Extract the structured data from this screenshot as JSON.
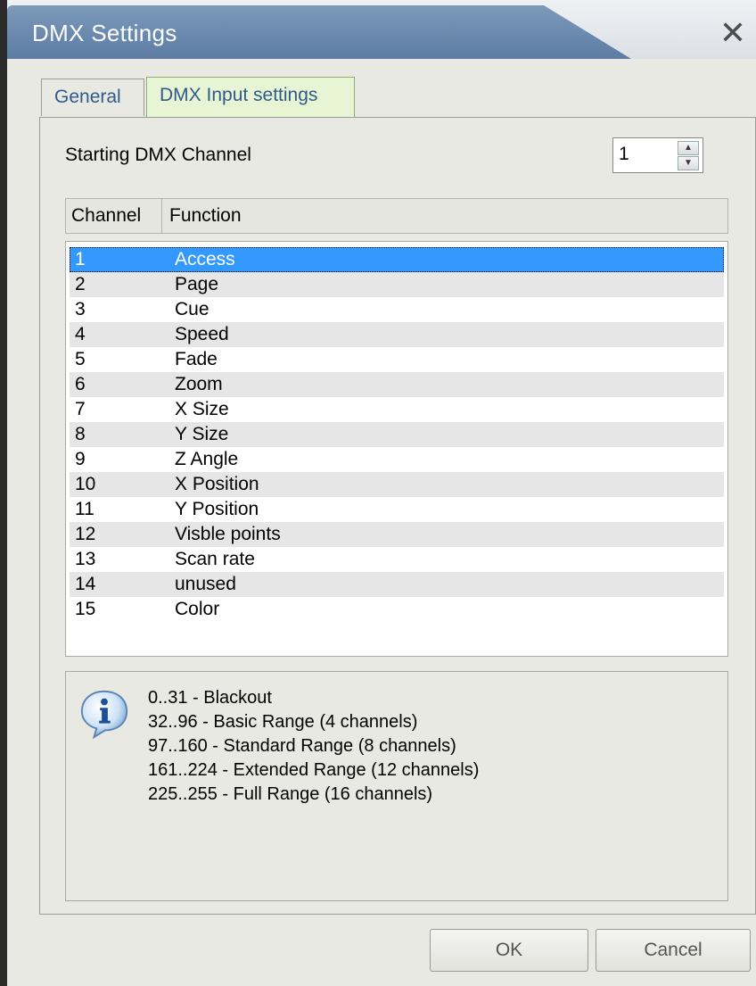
{
  "window": {
    "title": "DMX Settings",
    "close_glyph": "✕"
  },
  "tabs": [
    {
      "label": "General"
    },
    {
      "label": "DMX Input settings"
    }
  ],
  "start_channel": {
    "label": "Starting DMX Channel",
    "value": "1"
  },
  "table": {
    "columns": [
      "Channel",
      "Function"
    ],
    "rows": [
      {
        "channel": "1",
        "function": "Access"
      },
      {
        "channel": "2",
        "function": "Page"
      },
      {
        "channel": "3",
        "function": "Cue"
      },
      {
        "channel": "4",
        "function": "Speed"
      },
      {
        "channel": "5",
        "function": "Fade"
      },
      {
        "channel": "6",
        "function": "Zoom"
      },
      {
        "channel": "7",
        "function": "X Size"
      },
      {
        "channel": "8",
        "function": "Y Size"
      },
      {
        "channel": "9",
        "function": "Z Angle"
      },
      {
        "channel": "10",
        "function": "X Position"
      },
      {
        "channel": "11",
        "function": "Y Position"
      },
      {
        "channel": "12",
        "function": "Visble points"
      },
      {
        "channel": "13",
        "function": "Scan rate"
      },
      {
        "channel": "14",
        "function": "unused"
      },
      {
        "channel": "15",
        "function": "Color"
      }
    ]
  },
  "info": {
    "icon": "info-icon",
    "lines": [
      "0..31 - Blackout",
      "32..96 - Basic Range (4 channels)",
      "97..160 - Standard Range (8 channels)",
      "161..224 - Extended Range (12 channels)",
      "225..255 - Full Range (16 channels)"
    ]
  },
  "buttons": {
    "ok": "OK",
    "cancel": "Cancel"
  },
  "colors": {
    "title_bar": "#6b8ab0",
    "selection": "#3399ff",
    "active_tab": "#e8f5d4"
  }
}
